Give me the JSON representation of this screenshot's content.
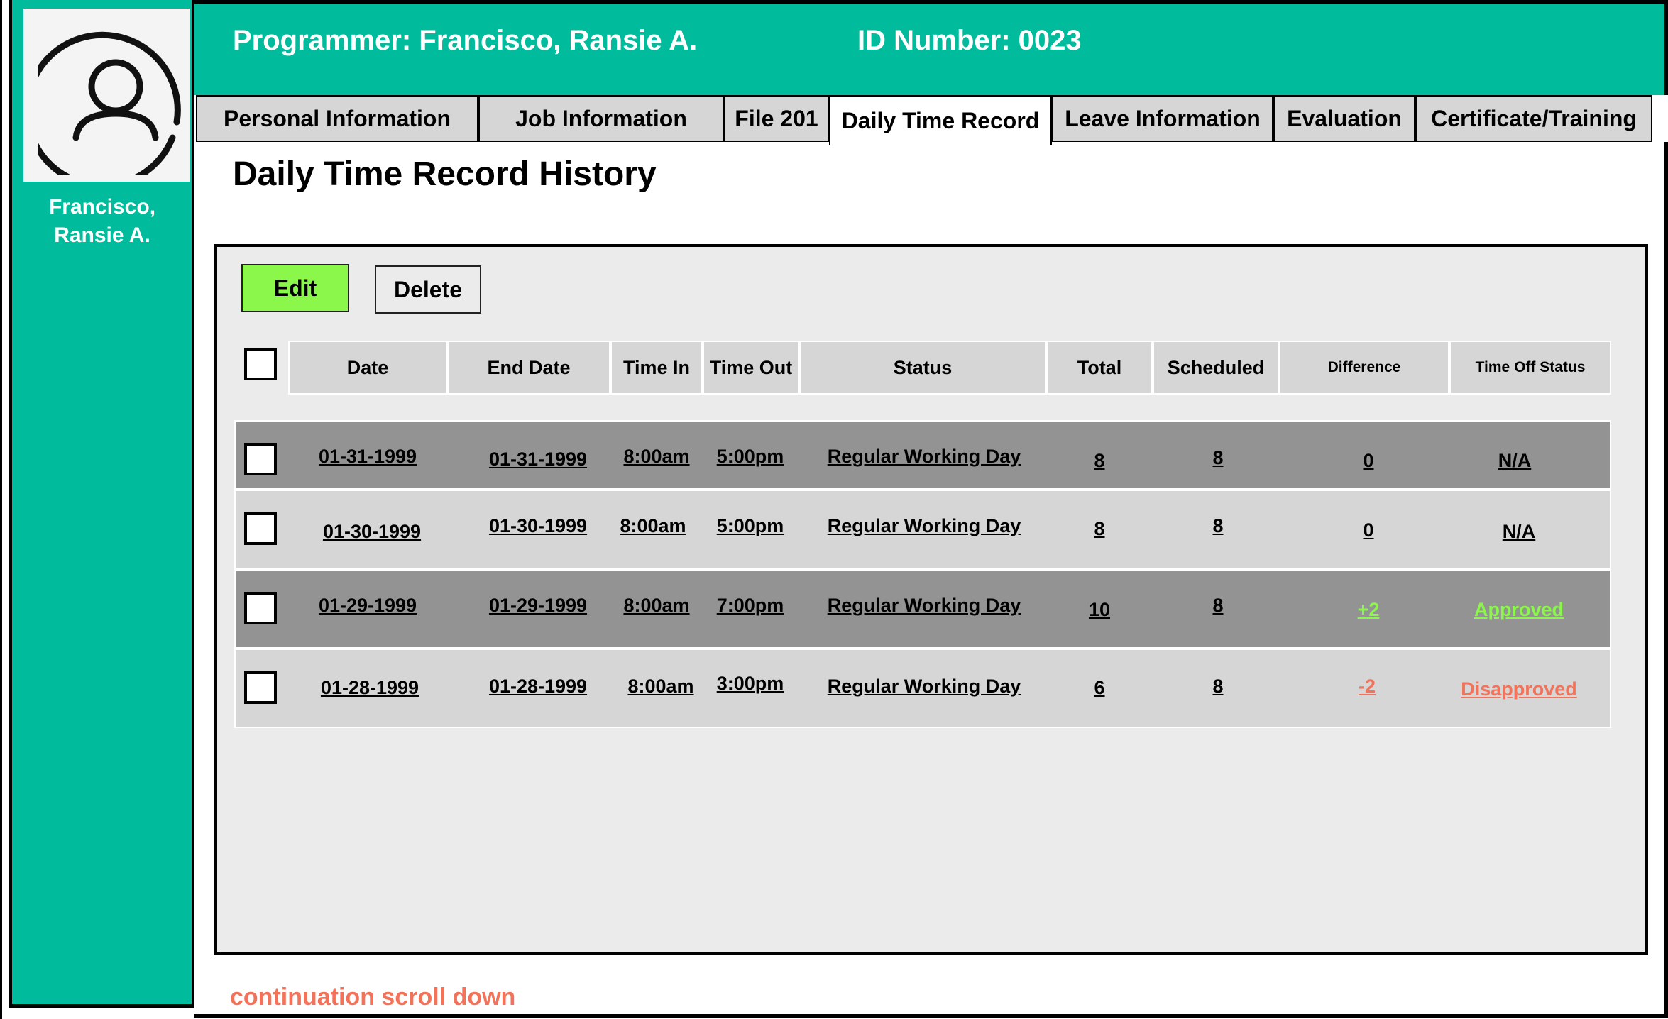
{
  "profile": {
    "name_line1": "Francisco,",
    "name_line2": "Ransie A."
  },
  "header": {
    "programmer": "Programmer:  Francisco, Ransie A.",
    "id_number": "ID Number:  0023"
  },
  "tabs": [
    {
      "label": "Personal Information",
      "active": false
    },
    {
      "label": "Job Information",
      "active": false
    },
    {
      "label": "File 201",
      "active": false
    },
    {
      "label": "Daily Time Record",
      "active": true
    },
    {
      "label": "Leave Information",
      "active": false
    },
    {
      "label": "Evaluation",
      "active": false
    },
    {
      "label": "Certificate/Training",
      "active": false
    }
  ],
  "page_title": "Daily Time Record History",
  "actions": {
    "edit_label": "Edit",
    "delete_label": "Delete"
  },
  "table": {
    "columns": [
      "Date",
      "End Date",
      "Time In",
      "Time Out",
      "Status",
      "Total",
      "Scheduled",
      "Difference",
      "Time Off Status"
    ],
    "rows": [
      {
        "date": "01-31-1999",
        "end_date": "01-31-1999",
        "time_in": "8:00am",
        "time_out": "5:00pm",
        "status": "Regular Working Day",
        "total": "8",
        "scheduled": "8",
        "difference": "0",
        "time_off_status": "N/A"
      },
      {
        "date": "01-30-1999",
        "end_date": "01-30-1999",
        "time_in": "8:00am",
        "time_out": "5:00pm",
        "status": "Regular Working Day",
        "total": "8",
        "scheduled": "8",
        "difference": "0",
        "time_off_status": "N/A"
      },
      {
        "date": "01-29-1999",
        "end_date": "01-29-1999",
        "time_in": "8:00am",
        "time_out": "7:00pm",
        "status": "Regular Working Day",
        "total": "10",
        "scheduled": "8",
        "difference": "+2",
        "time_off_status": "Approved"
      },
      {
        "date": "01-28-1999",
        "end_date": "01-28-1999",
        "time_in": "8:00am",
        "time_out": "3:00pm",
        "status": "Regular Working Day",
        "total": "6",
        "scheduled": "8",
        "difference": "-2",
        "time_off_status": "Disapproved"
      }
    ]
  },
  "footer_note": "continuation scroll down",
  "colors": {
    "teal": "#00bc9d",
    "edit_green": "#8bf74b",
    "approved": "#8bf74b",
    "disapproved": "#f2735a",
    "row_dark": "#939393",
    "row_light": "#d6d6d6"
  }
}
